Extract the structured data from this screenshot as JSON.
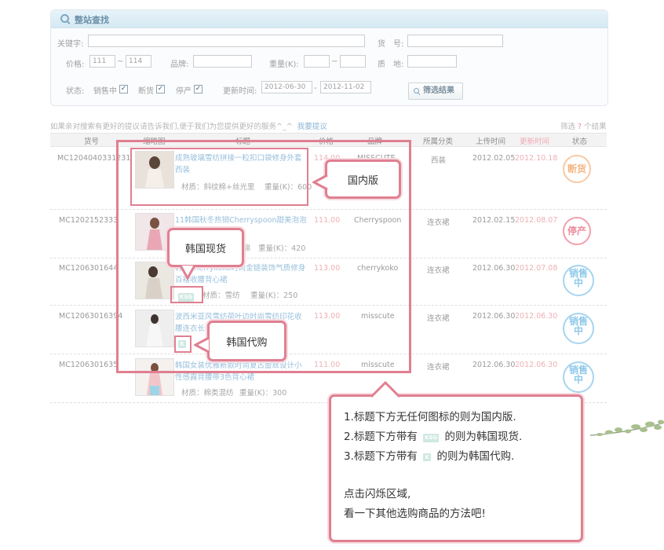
{
  "search": {
    "title": "整站查找",
    "labels": {
      "keyword": "关键字:",
      "item_no": "货　号:",
      "price": "价格:",
      "brand": "品牌:",
      "weight": "重量(K):",
      "origin": "质　地:",
      "status": "状态:",
      "update_time": "更新时间:"
    },
    "price_min": "111",
    "price_max": "114",
    "range_sep": "~",
    "date_sep": "-",
    "status_options": [
      {
        "label": "销售中",
        "checked": true
      },
      {
        "label": "断货",
        "checked": true
      },
      {
        "label": "停产",
        "checked": true
      }
    ],
    "date_from": "2012-06-30",
    "date_to": "2012-11-02",
    "filter_button": "筛选结果"
  },
  "results": {
    "suggest_text": "如果亲对搜索有更好的提议请告诉我们,便于我们为您提供更好的服务^_^",
    "suggest_link": "我要提议",
    "filter_prefix": "筛选",
    "filter_count": "?",
    "filter_suffix": "个结果",
    "columns": [
      "货号",
      "缩略图",
      "标题",
      "价格",
      "品牌",
      "所属分类",
      "上传时间",
      "更新时间",
      "状态"
    ],
    "rows": [
      {
        "id": "MC1204040331231",
        "title": "成熟玻璃雪纺拼接一粒扣口袋修身外套西装",
        "material": "材质：斜纹棉+丝光里",
        "weight": "重量(K)：600",
        "tag": "",
        "price": "114.00",
        "brand": "MISSCUTE",
        "category": "西装",
        "uploaded": "2012.02.05",
        "updated": "2012.10.18",
        "status": "断货"
      },
      {
        "id": "MC1202152333",
        "title": "11韩国秋冬热销Cherryspoon甜美泡泡袖连衣裙",
        "material": "材质：棉",
        "weight": "重量(K)：420",
        "tag": "",
        "price": "111.00",
        "brand": "Cherryspoon",
        "category": "连衣裙",
        "uploaded": "2012.02.15",
        "updated": "2012.08.07",
        "status": "停产"
      },
      {
        "id": "MC1206301644",
        "title": "韩国cherrykoko时尚金链装饰气质修身百褶收腰背心裙",
        "material": "材质：雪纺",
        "weight": "重量(K)：250",
        "tag": "KSG",
        "price": "113.00",
        "brand": "cherrykoko",
        "category": "连衣裙",
        "uploaded": "2012.06.30",
        "updated": "2012.07.08",
        "status": "销售中"
      },
      {
        "id": "MC12063016394",
        "title": "波西米亚风雪纺荷叶边时尚雪纺印花收腰连衣长裙",
        "material": "",
        "weight": "",
        "tag": "K",
        "price": "113.00",
        "brand": "misscute",
        "category": "连衣裙",
        "uploaded": "2012.06.30",
        "updated": "2012.06.30",
        "status": "销售中"
      },
      {
        "id": "MC1206301635",
        "title": "韩国女装优雅新款时尚复古蕾丝设计小性感露背腰带3色背心裙",
        "material": "材质：棉类混纺",
        "weight": "重量(K)：300",
        "tag": "",
        "price": "111.00",
        "brand": "misscute",
        "category": "连衣裙",
        "uploaded": "2012.06.30",
        "updated": "2012.06.30",
        "status": "销售中"
      }
    ]
  },
  "overlay": {
    "label_domestic": "国内版",
    "label_ksg": "韩国现货",
    "label_korea_agent": "韩国代购",
    "ksg_icon_text": "KSG",
    "k_icon_text": "K",
    "line1": "1.标题下方无任何图标的则为国内版.",
    "line2_a": "2.标题下方带有",
    "line2_b": "的则为韩国现货.",
    "line3_a": "3.标题下方带有",
    "line3_b": "的则为韩国代购.",
    "line4": "点击闪烁区域,",
    "line5": "看一下其他选购商品的方法吧!"
  },
  "colors": {
    "accent": "#e07f91",
    "link": "#97bfdc",
    "price": "#eeb0b6",
    "tag": "#cfe8e2"
  }
}
